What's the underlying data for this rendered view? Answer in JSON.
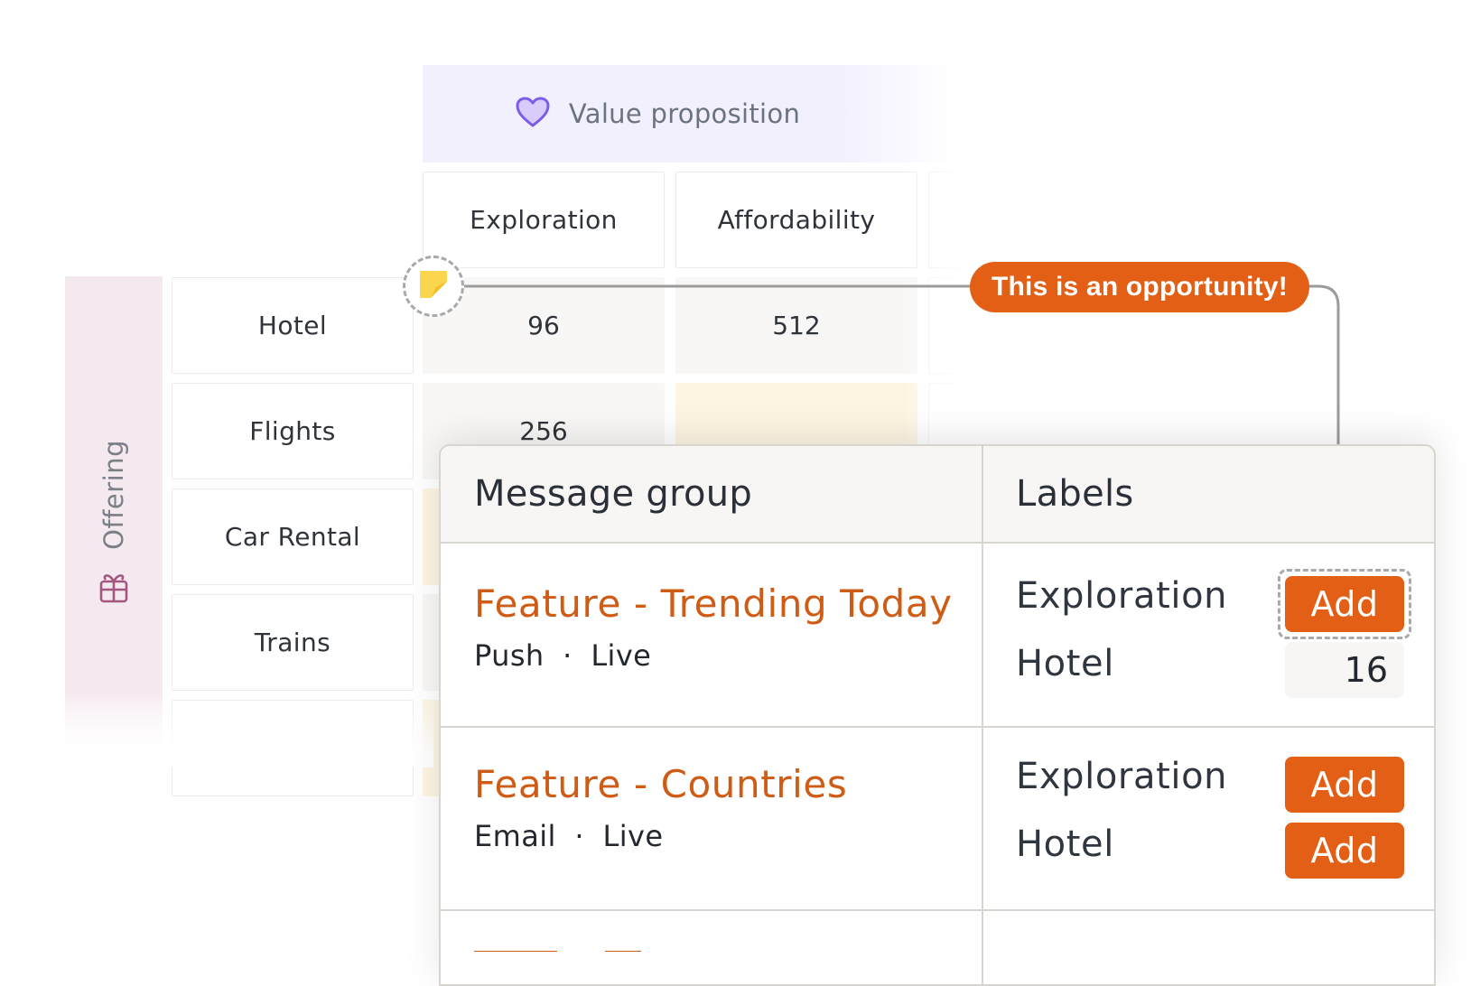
{
  "matrix": {
    "value_proposition_title": "Value proposition",
    "offering_title": "Offering",
    "columns": [
      "Exploration",
      "Affordability"
    ],
    "rows": [
      "Hotel",
      "Flights",
      "Car Rental",
      "Trains"
    ],
    "cells": {
      "hotel_exploration": "96",
      "hotel_affordability": "512",
      "flights_exploration": "256"
    },
    "colors": {
      "value_prop_bg": "#f3f0fe",
      "offering_bg": "#f5e9f0",
      "highlight_cell": "#fdf5e2"
    }
  },
  "annotation": {
    "callout_text": "This is an opportunity!",
    "accent_color": "#e35f16"
  },
  "table": {
    "header_message_group": "Message group",
    "header_labels": "Labels",
    "rows": [
      {
        "title": "Feature - Trending Today",
        "channel": "Push",
        "separator": "·",
        "status": "Live",
        "label_1": "Exploration",
        "label_1_action": "Add",
        "label_2": "Hotel",
        "label_2_count": "16"
      },
      {
        "title": "Feature - Countries",
        "channel": "Email",
        "separator": "·",
        "status": "Live",
        "label_1": "Exploration",
        "label_1_action": "Add",
        "label_2": "Hotel",
        "label_2_action": "Add"
      }
    ]
  },
  "icons": {
    "value_proposition": "heart-icon",
    "offering": "gift-icon",
    "opportunity": "sticky-note-icon"
  }
}
